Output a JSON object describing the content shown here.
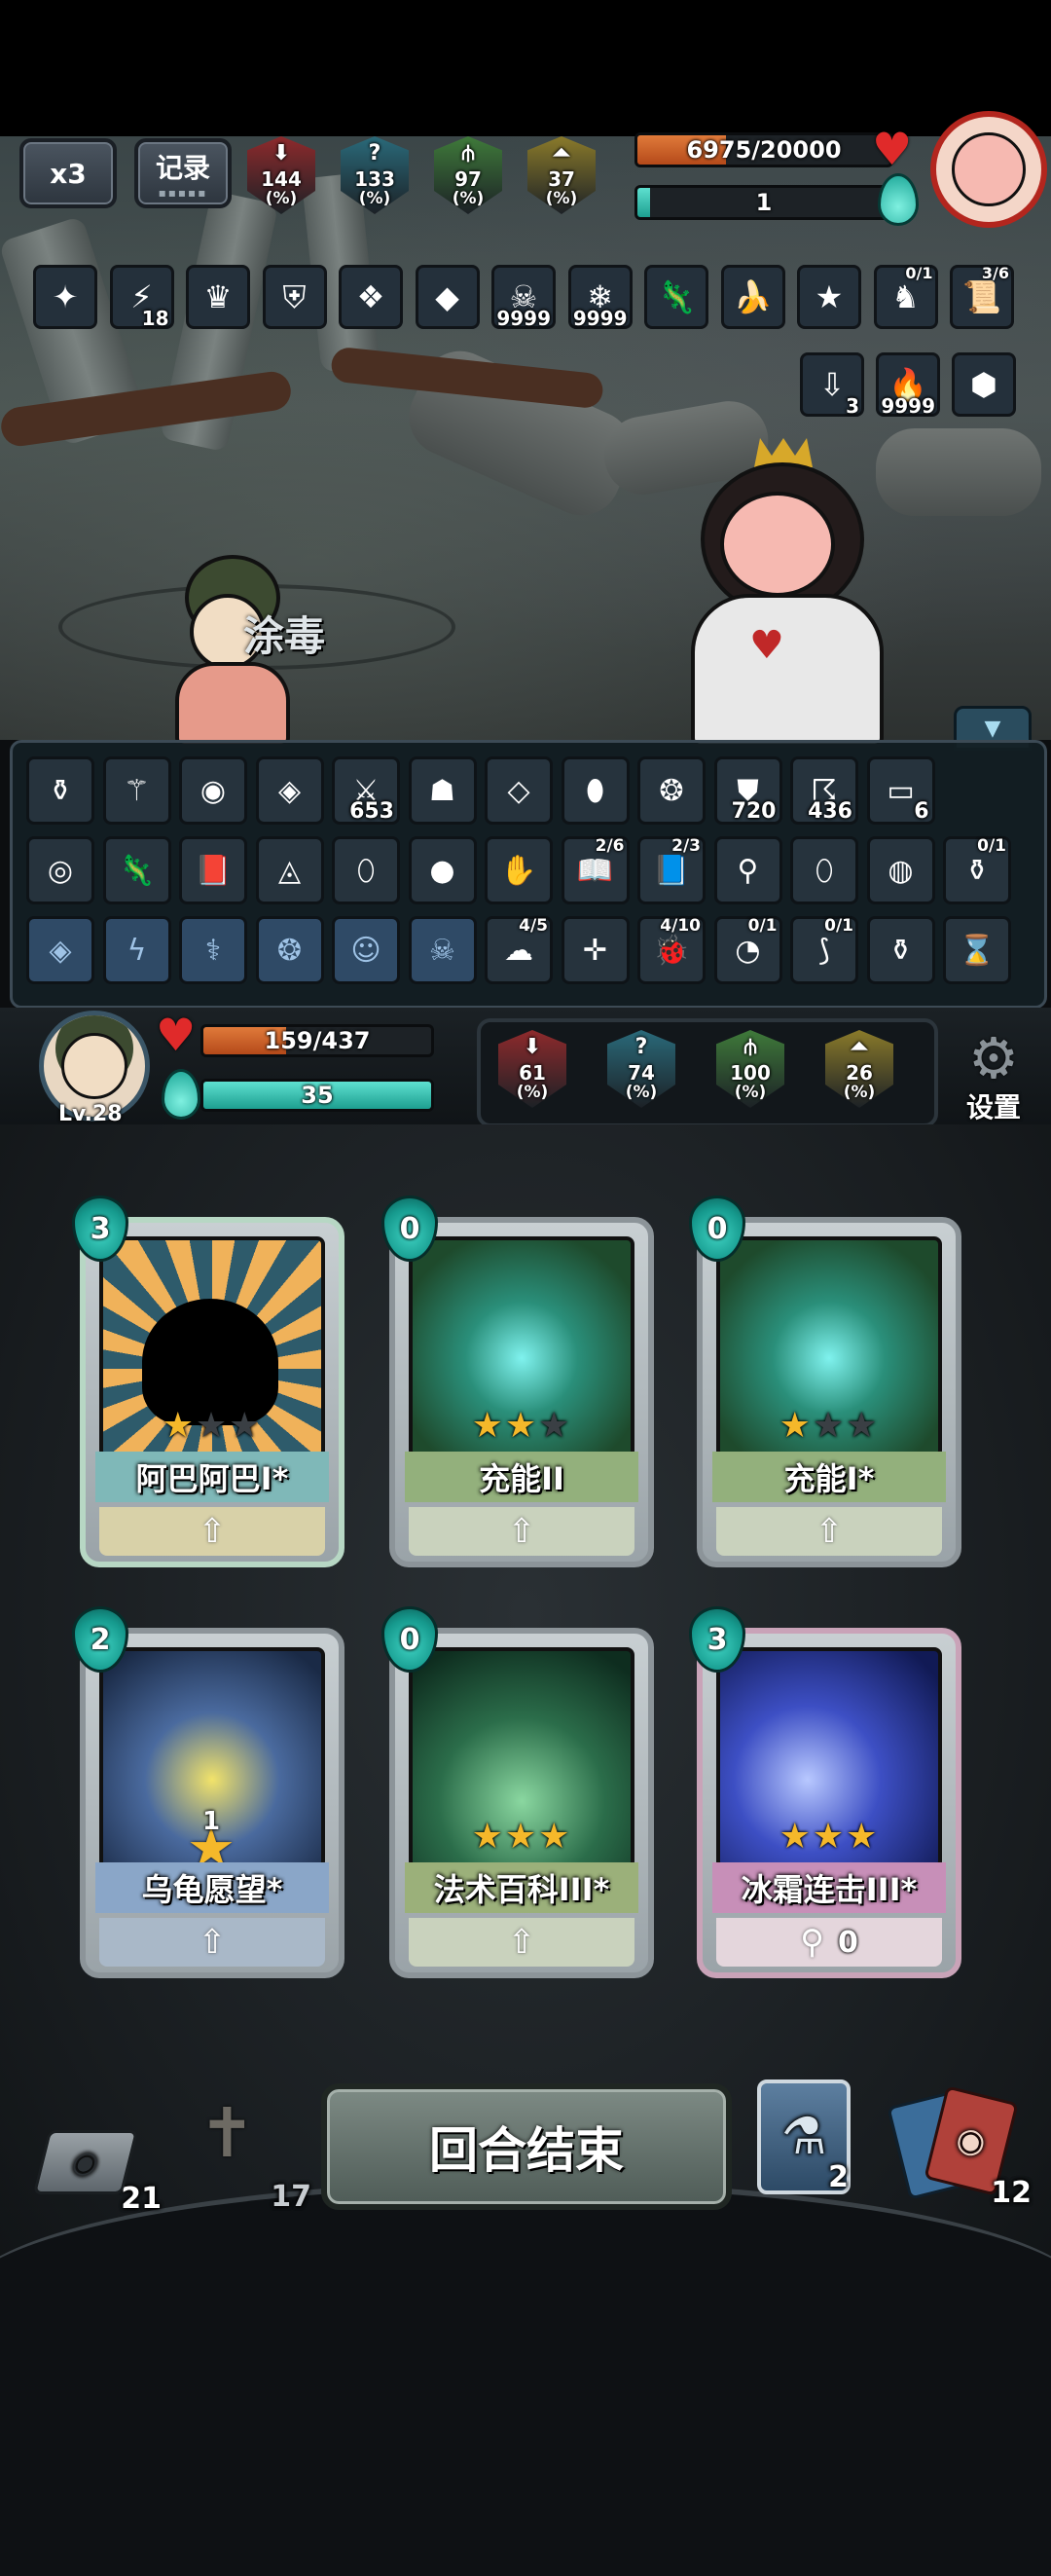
{
  "top": {
    "speed_label": "x3",
    "record_label": "记录"
  },
  "enemy": {
    "stats": [
      {
        "glyph": "⬇",
        "value": "144",
        "unit": "(%)",
        "color": "#8e2a2c"
      },
      {
        "glyph": "?",
        "value": "133",
        "unit": "(%)",
        "color": "#2a6a7a"
      },
      {
        "glyph": "⫛",
        "value": "97",
        "unit": "(%)",
        "color": "#3f7a3a"
      },
      {
        "glyph": "⏶",
        "value": "37",
        "unit": "(%)",
        "color": "#8a7a2a"
      }
    ],
    "hp_text": "6975/20000",
    "hp_fraction": 0.349,
    "mana_text": "1",
    "mana_fraction": 0.05,
    "status_icons": [
      {
        "icon": "rune-icon",
        "glyph": "✦",
        "count": ""
      },
      {
        "icon": "lightning-icon",
        "glyph": "⚡",
        "count": "18"
      },
      {
        "icon": "crown-spikes-icon",
        "glyph": "♛",
        "count": ""
      },
      {
        "icon": "shield-swap-icon",
        "glyph": "⛨",
        "count": ""
      },
      {
        "icon": "ice-shard-icon",
        "glyph": "❖",
        "count": ""
      },
      {
        "icon": "gem-icon",
        "glyph": "◆",
        "count": ""
      },
      {
        "icon": "poison-skull-icon",
        "glyph": "☠",
        "count": "9999"
      },
      {
        "icon": "frost-icon",
        "glyph": "❄",
        "count": "9999"
      },
      {
        "icon": "lizard-icon",
        "glyph": "🦎",
        "count": ""
      },
      {
        "icon": "banana-icon",
        "glyph": "🍌",
        "count": ""
      },
      {
        "icon": "star-wand-icon",
        "glyph": "★",
        "count": ""
      },
      {
        "icon": "knight-icon",
        "glyph": "♞",
        "frac": "0/1"
      },
      {
        "icon": "scroll-icon",
        "glyph": "📜",
        "frac": "3/6"
      }
    ],
    "status_icons_row2": [
      {
        "icon": "down-arrow-icon",
        "glyph": "⇩",
        "count": "3"
      },
      {
        "icon": "fire-icon",
        "glyph": "🔥",
        "count": "9999"
      },
      {
        "icon": "turtle-shell-icon",
        "glyph": "⬢",
        "count": ""
      }
    ]
  },
  "player": {
    "name_floating": "涂毒",
    "level": "Lv.28",
    "hp_text": "159/437",
    "hp_fraction": 0.364,
    "mana_text": "35",
    "mana_fraction": 1.0,
    "stats": [
      {
        "glyph": "⬇",
        "value": "61",
        "unit": "(%)",
        "color": "#8e2a2c"
      },
      {
        "glyph": "?",
        "value": "74",
        "unit": "(%)",
        "color": "#2a6a7a"
      },
      {
        "glyph": "⫛",
        "value": "100",
        "unit": "(%)",
        "color": "#3f7a3a"
      },
      {
        "glyph": "⏶",
        "value": "26",
        "unit": "(%)",
        "color": "#8a7a2a"
      }
    ],
    "settings_label": "设置"
  },
  "relics": {
    "row1": [
      {
        "icon": "potion-bottle-icon",
        "glyph": "⚱",
        "count": ""
      },
      {
        "icon": "magic-staff-icon",
        "glyph": "⚚",
        "count": ""
      },
      {
        "icon": "eye-mask-icon",
        "glyph": "◉",
        "count": ""
      },
      {
        "icon": "crystal-icon",
        "glyph": "◈",
        "count": ""
      },
      {
        "icon": "sword-slash-icon",
        "glyph": "⚔",
        "count": "653"
      },
      {
        "icon": "demon-mask-icon",
        "glyph": "☗",
        "count": ""
      },
      {
        "icon": "diamond-icon",
        "glyph": "◇",
        "count": ""
      },
      {
        "icon": "dragon-egg-icon",
        "glyph": "⬮",
        "count": ""
      },
      {
        "icon": "ice-gem-icon",
        "glyph": "❂",
        "count": ""
      },
      {
        "icon": "shield-blue-icon",
        "glyph": "⛊",
        "count": "720"
      },
      {
        "icon": "storm-icon",
        "glyph": "☈",
        "count": "436"
      },
      {
        "icon": "cards-icon",
        "glyph": "▭",
        "count": "6"
      }
    ],
    "row2": [
      {
        "icon": "ghost-orb-icon",
        "glyph": "◎",
        "count": ""
      },
      {
        "icon": "chameleon-icon",
        "glyph": "🦎",
        "count": ""
      },
      {
        "icon": "spellbook-icon",
        "glyph": "📕",
        "count": ""
      },
      {
        "icon": "onigiri-icon",
        "glyph": "◬",
        "count": ""
      },
      {
        "icon": "egg-icon",
        "glyph": "⬯",
        "count": ""
      },
      {
        "icon": "blue-fruit-icon",
        "glyph": "●",
        "count": ""
      },
      {
        "icon": "glove-icon",
        "glyph": "✋",
        "count": ""
      },
      {
        "icon": "red-book-icon",
        "glyph": "📖",
        "frac": "2/6"
      },
      {
        "icon": "tome-icon",
        "glyph": "📘",
        "frac": "2/3"
      },
      {
        "icon": "broom-icon",
        "glyph": "⚲",
        "count": ""
      },
      {
        "icon": "green-egg-icon",
        "glyph": "⬯",
        "count": ""
      },
      {
        "icon": "crystal-ball-icon",
        "glyph": "◍",
        "count": ""
      },
      {
        "icon": "pouch-icon",
        "glyph": "⚱",
        "frac": "0/1"
      }
    ],
    "row3": [
      {
        "icon": "rune-diamond-icon",
        "glyph": "◈",
        "rune": true
      },
      {
        "icon": "rune-zigzag-icon",
        "glyph": "ϟ",
        "rune": true
      },
      {
        "icon": "rune-caduceus-icon",
        "glyph": "⚕",
        "rune": true
      },
      {
        "icon": "rune-swirl-icon",
        "glyph": "❂",
        "rune": true
      },
      {
        "icon": "rune-face-icon",
        "glyph": "☺",
        "rune": true
      },
      {
        "icon": "rune-skull-icon",
        "glyph": "☠",
        "rune": true
      },
      {
        "icon": "weather-icon",
        "glyph": "☁",
        "frac": "4/5"
      },
      {
        "icon": "crossbow-icon",
        "glyph": "✛",
        "count": ""
      },
      {
        "icon": "beetle-icon",
        "glyph": "🐞",
        "frac": "4/10"
      },
      {
        "icon": "pacifier-icon",
        "glyph": "◔",
        "frac": "0/1"
      },
      {
        "icon": "boomerang-icon",
        "glyph": "⟆",
        "frac": "0/1"
      },
      {
        "icon": "sack-icon",
        "glyph": "⚱",
        "count": ""
      },
      {
        "icon": "hourglass-icon",
        "glyph": "⌛",
        "count": ""
      }
    ]
  },
  "hand": [
    {
      "cost": "3",
      "name": "阿巴阿巴I*",
      "stars": 1,
      "theme": "sun",
      "foot": "⇧",
      "foot_label": ""
    },
    {
      "cost": "0",
      "name": "充能II",
      "stars": 2,
      "theme": "charge",
      "foot": "⇧",
      "foot_label": ""
    },
    {
      "cost": "0",
      "name": "充能I*",
      "stars": 1,
      "theme": "charge",
      "foot": "⇧",
      "foot_label": ""
    },
    {
      "cost": "2",
      "name": "乌龟愿望*",
      "stars": 1,
      "theme": "turtle",
      "foot": "⇧",
      "foot_label": "",
      "badge": "1"
    },
    {
      "cost": "0",
      "name": "法术百科III*",
      "stars": 3,
      "theme": "lightning",
      "foot": "⇧",
      "foot_label": ""
    },
    {
      "cost": "3",
      "name": "冰霜连击III*",
      "stars": 3,
      "theme": "frost",
      "foot": "⚲",
      "foot_label": "0"
    }
  ],
  "bottom": {
    "draw_pile": "21",
    "grave_pile": "17",
    "end_turn_label": "回合结束",
    "potion_count": "2",
    "discard_pile": "12"
  }
}
